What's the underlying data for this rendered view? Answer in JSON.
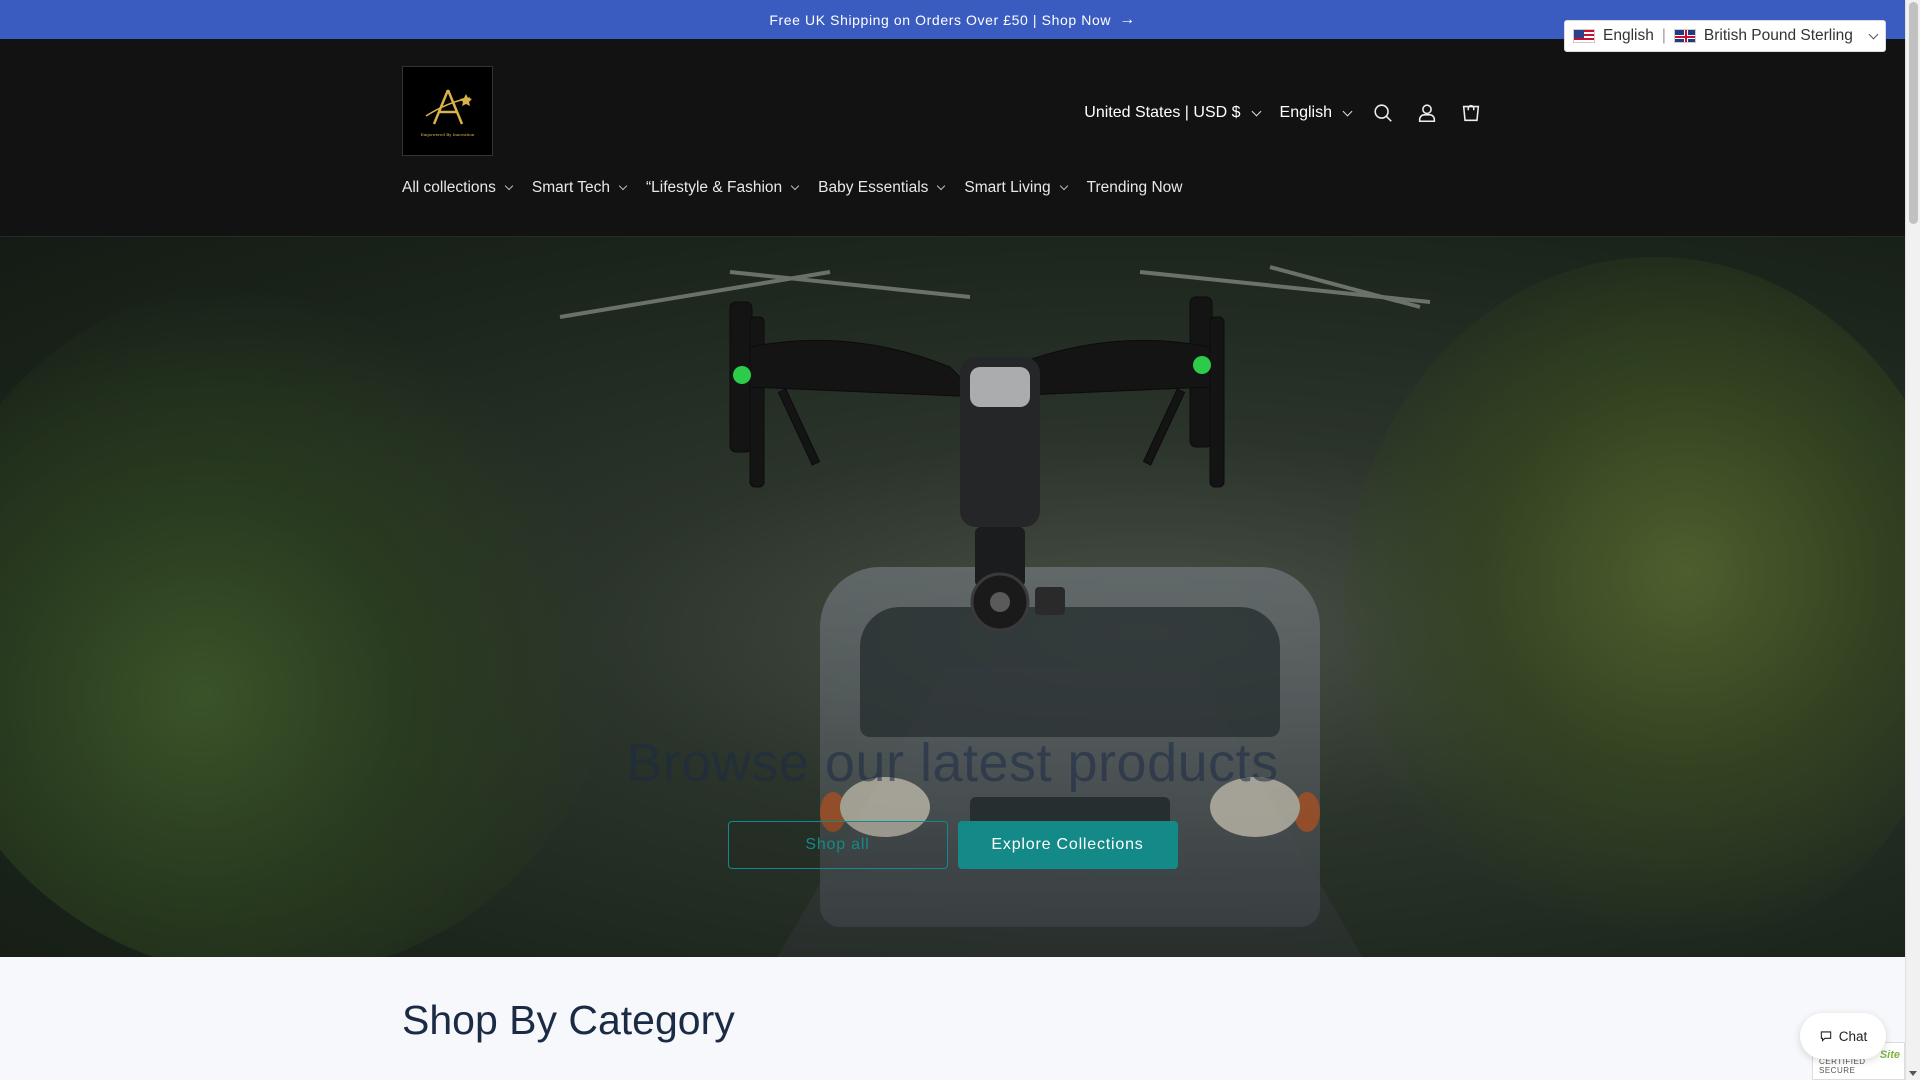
{
  "announcement": {
    "text": "Free UK Shipping on Orders Over £50 | Shop Now",
    "arrow": "→"
  },
  "header": {
    "logo_text": "Empowered By Innovation",
    "country_selector": "United States | USD $",
    "language_selector": "English",
    "icons": [
      "search-icon",
      "account-icon",
      "cart-icon"
    ]
  },
  "nav": {
    "items": [
      {
        "label": "All collections",
        "dropdown": true
      },
      {
        "label": "Smart Tech",
        "dropdown": true
      },
      {
        "label": "“Lifestyle & Fashion",
        "dropdown": true
      },
      {
        "label": "Baby Essentials",
        "dropdown": true
      },
      {
        "label": "Smart Living",
        "dropdown": true
      },
      {
        "label": "Trending Now",
        "dropdown": false
      }
    ]
  },
  "hero": {
    "title": "Browse our latest products",
    "primary_button": "Shop all",
    "secondary_button": "Explore Collections"
  },
  "section": {
    "title": "Shop By Category"
  },
  "lang_widget": {
    "language": "English",
    "separator": "|",
    "currency": "British Pound Sterling"
  },
  "chat": {
    "label": "Chat"
  },
  "trust_badge": {
    "brand": "Site",
    "caption": "CERTIFIED SECURE"
  },
  "colors": {
    "announce_bg": "#3a5bc0",
    "header_bg": "#121212",
    "accent": "#138a88",
    "heading": "#1b2a45"
  }
}
